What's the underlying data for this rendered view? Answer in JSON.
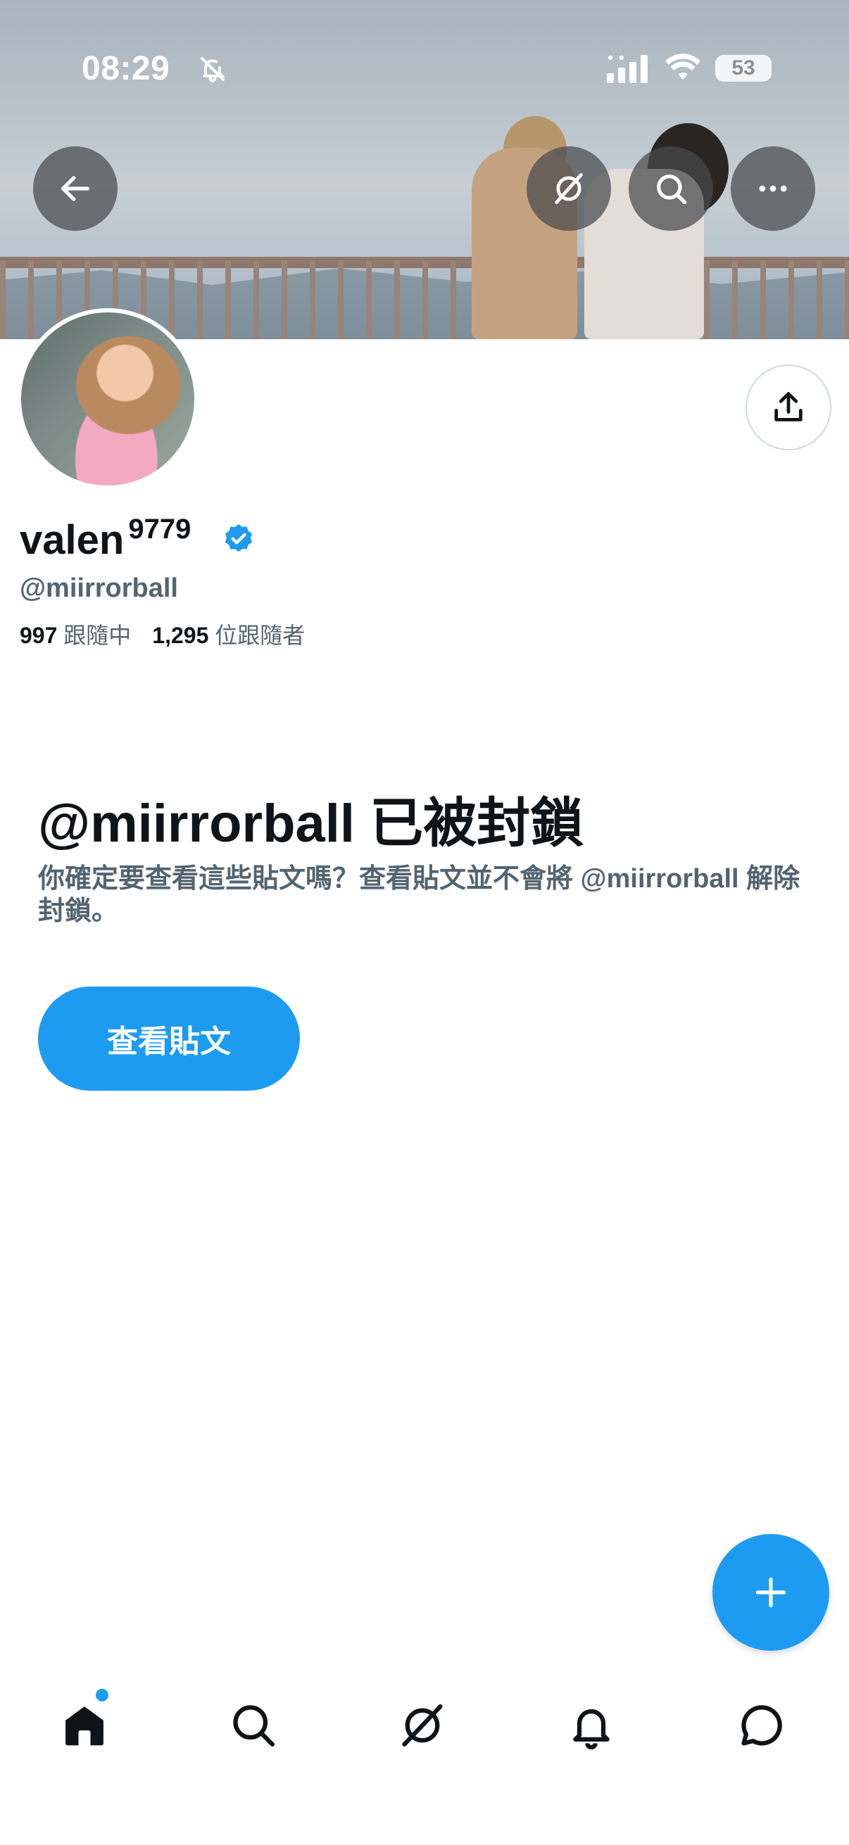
{
  "status_bar": {
    "time": "08:29",
    "battery": "53",
    "icons": [
      "bell-slash-icon",
      "cellular-signal-icon",
      "wifi-icon",
      "battery-icon"
    ]
  },
  "header": {
    "buttons": [
      "back-arrow-icon",
      "grok-icon",
      "search-icon",
      "more-icon"
    ]
  },
  "profile": {
    "display_name": "valen",
    "name_superscript": "9779",
    "verified": true,
    "handle": "@miirrorball",
    "following_count": "997",
    "following_label": "跟隨中",
    "followers_count": "1,295",
    "followers_label": "位跟隨者",
    "share_icon": "share-icon"
  },
  "blocked": {
    "title": "@miirrorball 已被封鎖",
    "description": "你確定要查看這些貼文嗎？查看貼文並不會將 @miirrorball 解除封鎖。",
    "button_label": "查看貼文"
  },
  "fab": {
    "icon": "plus-icon"
  },
  "bottom_nav": {
    "items": [
      "home-icon",
      "search-icon",
      "grok-icon",
      "bell-icon",
      "message-icon"
    ],
    "accent": "#1d9bf0"
  },
  "colors": {
    "accent": "#1d9bf0",
    "text_primary": "#0f1419",
    "text_secondary": "#536471"
  }
}
